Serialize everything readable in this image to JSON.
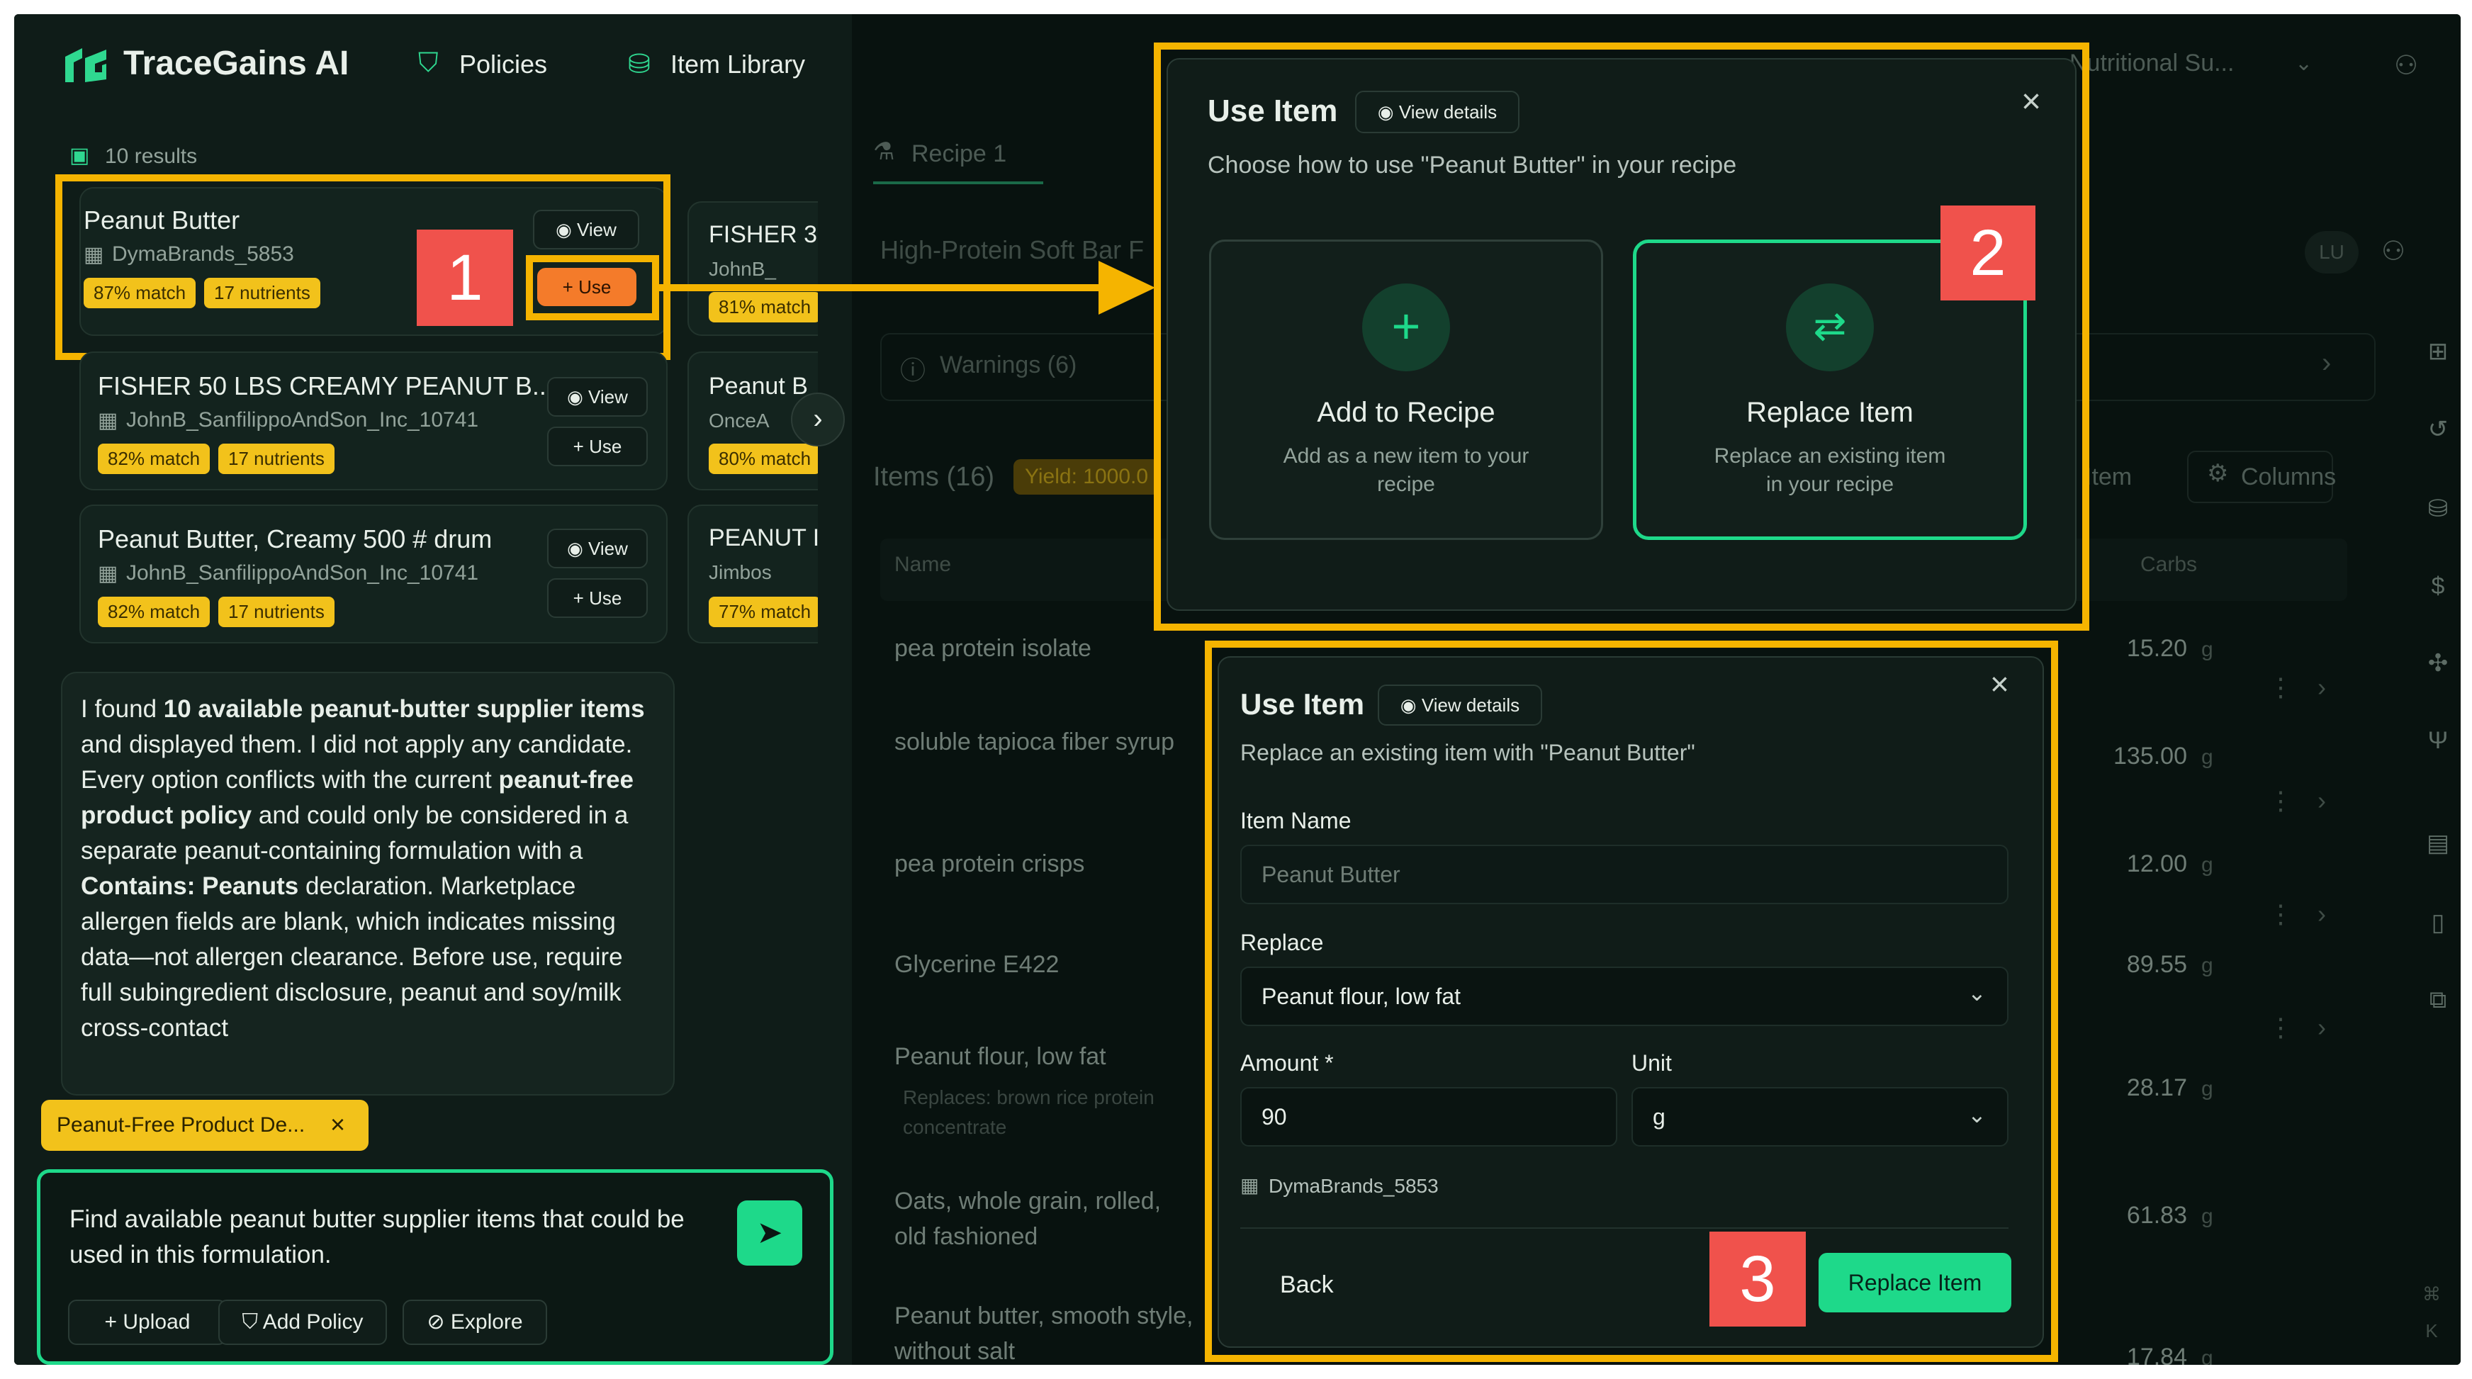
{
  "brand": {
    "name": "TraceGains AI"
  },
  "nav": {
    "policies": "Policies",
    "item_library": "Item Library",
    "nutritional": "Nutritional Su..."
  },
  "results": {
    "count": "10 results"
  },
  "items": [
    {
      "name": "Peanut Butter",
      "supplier": "DymaBrands_5853",
      "match": "87% match",
      "nutrients": "17 nutrients",
      "view": "View",
      "use": "+ Use"
    },
    {
      "name": "FISHER 50 LBS CREAMY PEANUT B...",
      "supplier": "JohnB_SanfilippoAndSon_Inc_10741",
      "match": "82% match",
      "nutrients": "17 nutrients",
      "view": "View",
      "use": "+ Use"
    },
    {
      "name": "Peanut Butter, Creamy 500 # drum",
      "supplier": "JohnB_SanfilippoAndSon_Inc_10741",
      "match": "82% match",
      "nutrients": "17 nutrients",
      "view": "View",
      "use": "+ Use"
    }
  ],
  "peek": [
    {
      "name": "FISHER 3",
      "supplier": "JohnB_",
      "match": "81% match"
    },
    {
      "name": "Peanut B",
      "supplier": "OnceA",
      "match": "80% match"
    },
    {
      "name": "PEANUT I",
      "supplier": "Jimbos",
      "match": "77% match"
    }
  ],
  "chat": {
    "p1a": "I found ",
    "p1b": "10 available peanut-butter supplier items",
    "p1c": " and displayed them. I did not apply any candidate.",
    "p2a": "Every option conflicts with the current ",
    "p2b": "peanut-free product policy",
    "p2c": " and could only be considered in a separate peanut-containing formulation with a ",
    "p2d": "Contains: Peanuts",
    "p2e": " declaration. Marketplace allergen fields are blank, which indicates missing data—not allergen clearance. Before use, require full subingredient disclosure, peanut and soy/milk cross-contact"
  },
  "policy_chip": "Peanut-Free Product De...",
  "composer": {
    "text": "Find available peanut butter supplier items that could be used in this formulation.",
    "upload": "Upload",
    "add_policy": "Add Policy",
    "explore": "Explore"
  },
  "recipe": {
    "tab": "Recipe 1",
    "title": "High-Protein Soft Bar F",
    "user": "LU",
    "warnings": "Warnings (6)",
    "items_label": "Items (16)",
    "yield": "Yield: 1000.0",
    "add_item": "Item",
    "columns": "Columns",
    "col_name": "Name",
    "col_carbs": "Carbs",
    "rows": [
      {
        "name": "pea protein isolate",
        "carbs": "15.20",
        "unit": "g"
      },
      {
        "name": "soluble tapioca fiber syrup",
        "carbs": "135.00",
        "unit": "g"
      },
      {
        "name": "pea protein crisps",
        "carbs": "12.00",
        "unit": "g"
      },
      {
        "name": "Glycerine E422",
        "carbs": "89.55",
        "unit": "g"
      },
      {
        "name": "Peanut flour, low fat",
        "sub": "Replaces: brown rice protein concentrate",
        "carbs": "28.17",
        "unit": "g"
      },
      {
        "name": "Oats, whole grain, rolled, old fashioned",
        "carbs": "61.83",
        "unit": "g"
      },
      {
        "name": "Peanut butter, smooth style, without salt",
        "carbs": "17.84",
        "unit": "g"
      }
    ]
  },
  "modal1": {
    "title": "Use Item",
    "view_details": "View details",
    "subtitle": "Choose how to use \"Peanut Butter\" in your recipe",
    "opt1_title": "Add to Recipe",
    "opt1_desc": "Add as a new item to your recipe",
    "opt2_title": "Replace Item",
    "opt2_desc": "Replace an existing item in your recipe"
  },
  "modal2": {
    "title": "Use Item",
    "view_details": "View details",
    "subtitle": "Replace an existing item with \"Peanut Butter\"",
    "item_name_label": "Item Name",
    "item_name_value": "Peanut Butter",
    "replace_label": "Replace",
    "replace_value": "Peanut flour, low fat",
    "amount_label": "Amount *",
    "amount_value": "90",
    "unit_label": "Unit",
    "unit_value": "g",
    "supplier": "DymaBrands_5853",
    "back": "Back",
    "replace_btn": "Replace Item"
  },
  "steps": [
    "1",
    "2",
    "3"
  ],
  "colors": {
    "accent": "#1ed98a",
    "highlight": "#f5b400",
    "step": "#f0524c",
    "badge": "#f2c21b"
  }
}
